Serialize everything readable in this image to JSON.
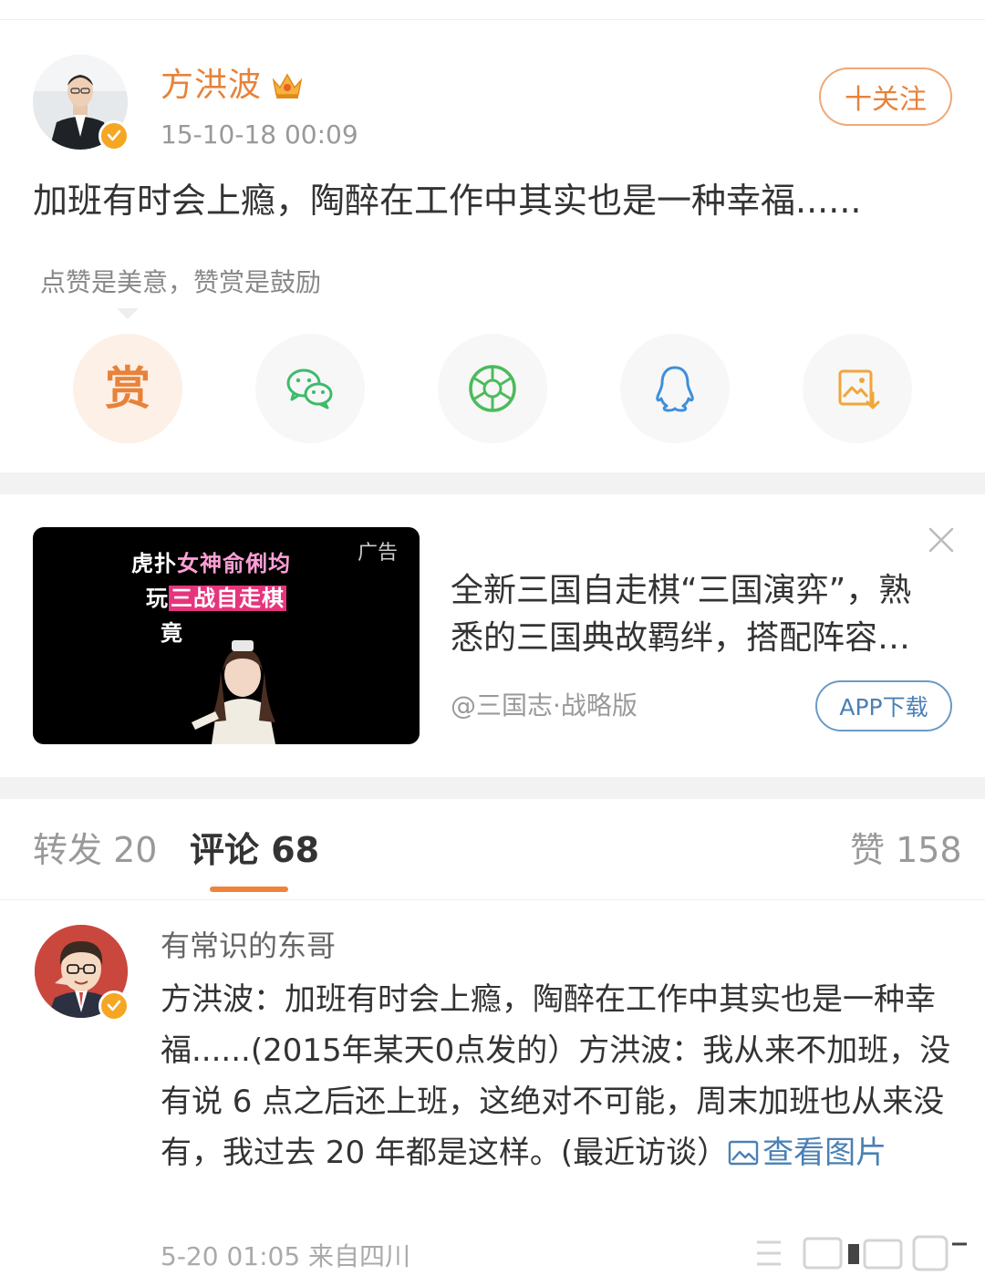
{
  "post": {
    "author": "方洪波",
    "time": "15-10-18 00:09",
    "follow_label": "十关注",
    "text": "加班有时会上瘾，陶醉在工作中其实也是一种幸福......",
    "reward_hint": "点赞是美意，赞赏是鼓励",
    "share": {
      "reward_label": "赏",
      "icons": [
        "wechat-icon",
        "moments-icon",
        "qq-icon",
        "save-image-icon"
      ]
    }
  },
  "ad": {
    "overlay": {
      "line1_a": "虎扑",
      "line1_b": "女神俞俐均",
      "line2_a": "玩",
      "line2_b": "三战自走棋",
      "line3": "竟"
    },
    "tag": "广告",
    "title": "全新三国自走棋“三国演弈”，熟悉的三国典故羁绊，搭配阵容…",
    "source": "@三国志·战略版",
    "download_label": "APP下载"
  },
  "tabs": {
    "repost": "转发 20",
    "comment": "评论 68",
    "like": "赞 158"
  },
  "comment": {
    "user": "有常识的东哥",
    "text": "方洪波：加班有时会上瘾，陶醉在工作中其实也是一种幸福......(2015年某天0点发的）方洪波：我从来不加班，没有说 6 点之后还上班，这绝对不可能，周末加班也从来没有，我过去 20 年都是这样。(最近访谈）",
    "view_pic": "查看图片",
    "meta": "5-20 01:05  来自四川"
  },
  "colors": {
    "accent_orange": "#e8823a",
    "link_blue": "#4a80b5",
    "verified_badge": "#f5a623"
  }
}
